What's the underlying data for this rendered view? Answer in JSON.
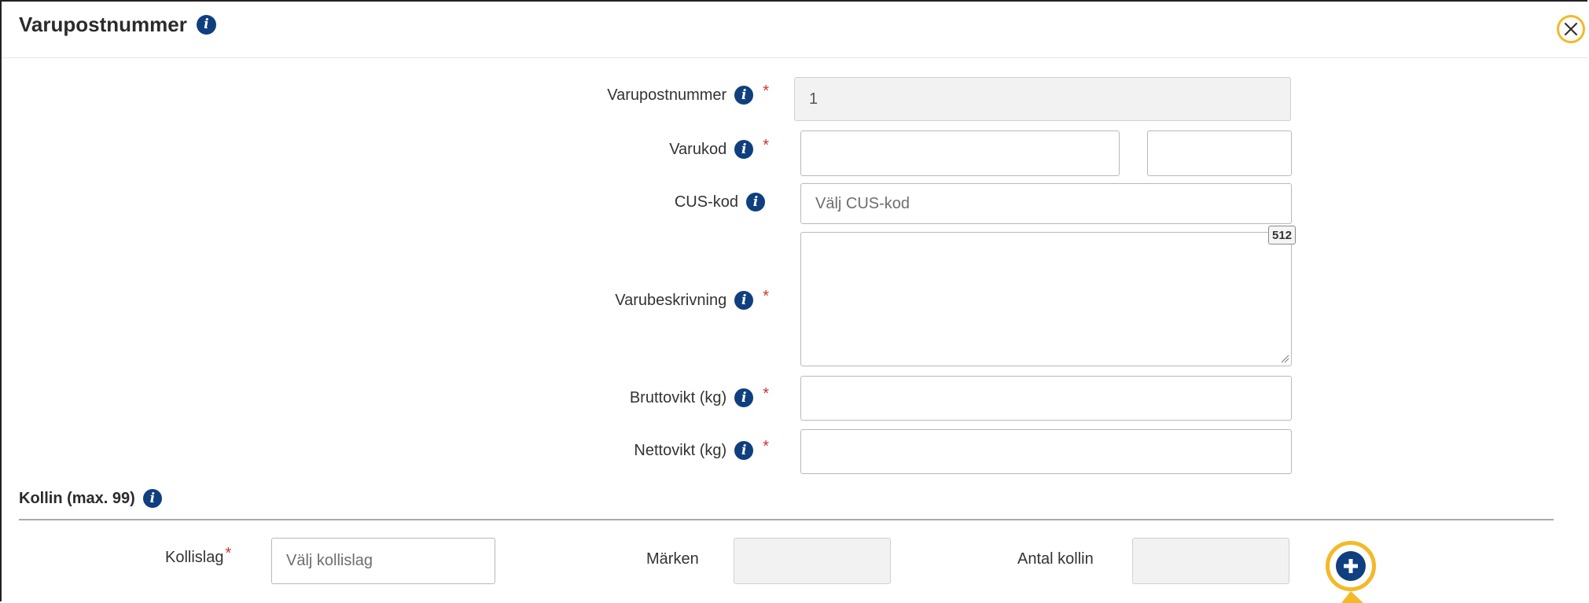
{
  "dialog": {
    "title": "Varupostnummer",
    "close_icon": "close-icon"
  },
  "form": {
    "varupostnummer": {
      "label": "Varupostnummer",
      "required": true,
      "value": "1",
      "disabled": true
    },
    "varukod": {
      "label": "Varukod",
      "required": true,
      "value_main": "",
      "value_ext": ""
    },
    "cus_kod": {
      "label": "CUS-kod",
      "required": false,
      "placeholder": "Välj CUS-kod"
    },
    "varubeskrivning": {
      "label": "Varubeskrivning",
      "required": true,
      "value": "",
      "char_counter": "512"
    },
    "bruttovikt": {
      "label": "Bruttovikt (kg)",
      "required": true,
      "value": ""
    },
    "nettovikt": {
      "label": "Nettovikt (kg)",
      "required": true,
      "value": ""
    }
  },
  "kollin": {
    "section_title": "Kollin (max. 99)",
    "kollislag": {
      "label": "Kollislag",
      "required": true,
      "placeholder": "Välj kollislag"
    },
    "marken": {
      "label": "Märken",
      "value": ""
    },
    "antal_kollin": {
      "label": "Antal kollin",
      "value": ""
    },
    "add_icon": "plus-circle-icon"
  },
  "colors": {
    "info_icon": "#0f3f7f",
    "required_star": "#d0312d",
    "highlight_ring": "#f3b928",
    "disabled_field": "#f2f2f2"
  }
}
